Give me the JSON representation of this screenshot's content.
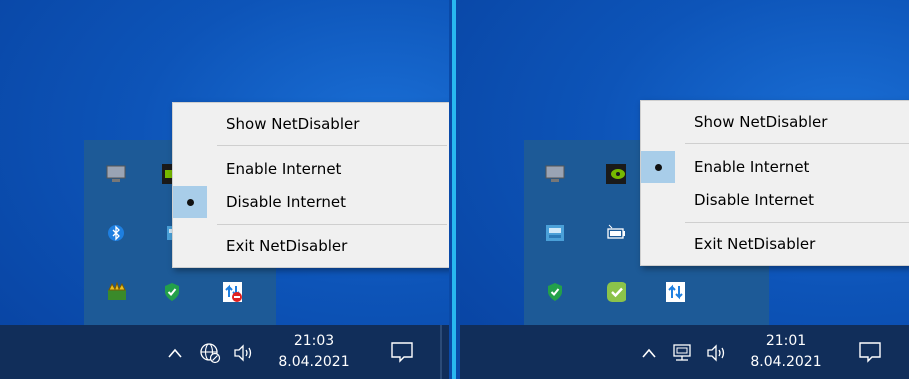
{
  "left": {
    "menu": {
      "items": [
        {
          "label": "Show NetDisabler",
          "checked": false
        },
        {
          "label": "Enable Internet",
          "checked": false
        },
        {
          "label": "Disable Internet",
          "checked": true
        },
        {
          "label": "Exit NetDisabler",
          "checked": false
        }
      ]
    },
    "taskbar": {
      "time": "21:03",
      "date": "8.04.2021",
      "chevron": "^"
    },
    "tray_icons": [
      "monitor-icon",
      "nvidia-icon",
      "bluetooth-icon",
      "network-app-icon",
      "usb-crown-icon",
      "shield-check-icon",
      "netdisabler-disabled-icon"
    ],
    "taskbar_icons": [
      "chevron-up-icon",
      "globe-disconnected-icon",
      "speaker-icon",
      "notification-icon"
    ]
  },
  "right": {
    "menu": {
      "items": [
        {
          "label": "Show NetDisabler",
          "checked": false
        },
        {
          "label": "Enable Internet",
          "checked": true
        },
        {
          "label": "Disable Internet",
          "checked": false
        },
        {
          "label": "Exit NetDisabler",
          "checked": false
        }
      ]
    },
    "taskbar": {
      "time": "21:01",
      "date": "8.04.2021",
      "chevron": "^"
    },
    "tray_icons": [
      "monitor-icon",
      "nvidia-icon",
      "network-app-icon",
      "battery-icon",
      "shield-check-icon",
      "green-check-icon",
      "netdisabler-enabled-icon"
    ],
    "taskbar_icons": [
      "chevron-up-icon",
      "network-wired-icon",
      "speaker-icon",
      "notification-icon"
    ]
  },
  "colors": {
    "desktop": "#0d54b8",
    "taskbar": "#112e5a",
    "menu_bg": "#f0f0f0",
    "highlight": "#a8cde9",
    "divider": "#28b8f0"
  }
}
